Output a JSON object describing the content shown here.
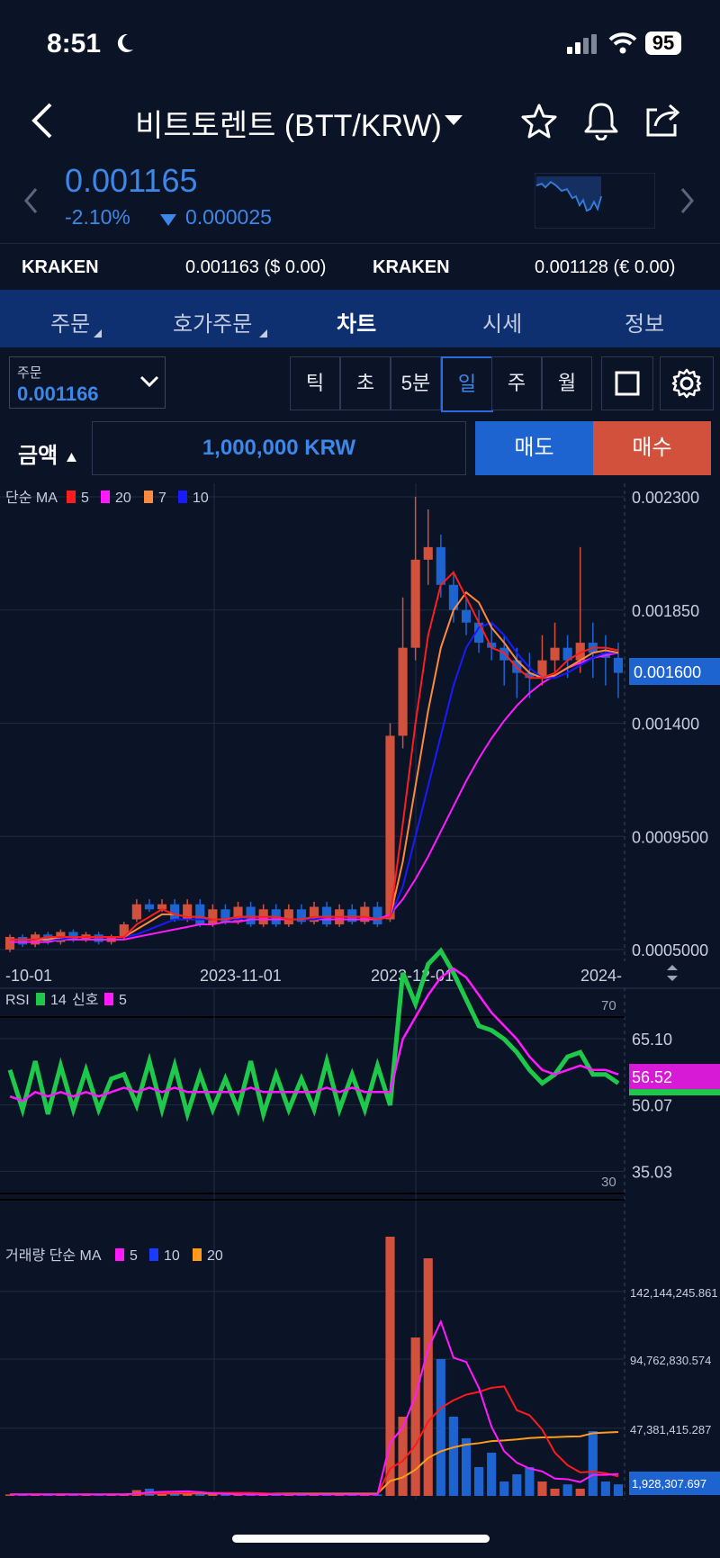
{
  "status": {
    "time": "8:51",
    "battery": "95"
  },
  "header": {
    "title": "비트토렌트 (BTT/KRW)"
  },
  "ticker": {
    "price": "0.001165",
    "change_pct": "-2.10%",
    "change_abs": "0.000025"
  },
  "exchanges": [
    {
      "name": "KRAKEN",
      "value": "0.001163 ($ 0.00)"
    },
    {
      "name": "KRAKEN",
      "value": "0.001128 (€ 0.00)"
    }
  ],
  "tabs": [
    "주문",
    "호가주문",
    "차트",
    "시세",
    "정보"
  ],
  "order": {
    "label": "주문",
    "value": "0.001166"
  },
  "timeframes": [
    "틱",
    "초",
    "5분",
    "일",
    "주",
    "월"
  ],
  "amount": {
    "label": "금액",
    "value": "1,000,000 KRW"
  },
  "actions": {
    "sell": "매도",
    "buy": "매수"
  },
  "colors": {
    "up": "#d2513c",
    "down": "#1d64d0",
    "accent": "#3d87e8",
    "bg": "#0b1427"
  },
  "chart_data": {
    "type": "candlestick",
    "price": {
      "legend_title": "단순 MA",
      "ma_legend": [
        {
          "color": "#ff1d1d",
          "value": "5"
        },
        {
          "color": "#ff1aff",
          "value": "20"
        },
        {
          "color": "#ff8a3d",
          "value": "7"
        },
        {
          "color": "#1a1aff",
          "value": "10"
        }
      ],
      "y_ticks": [
        "0.002300",
        "0.001850",
        "0.001400",
        "0.0009500",
        "0.0005000"
      ],
      "current_label": "0.001600",
      "x_ticks": [
        "-10-01",
        "2023-11-01",
        "2023-12-01",
        "2024-"
      ],
      "ma5": [
        0.00054,
        0.00054,
        0.00054,
        0.00055,
        0.00055,
        0.00055,
        0.00055,
        0.00055,
        0.00055,
        0.00055,
        0.0006,
        0.00063,
        0.00066,
        0.00064,
        0.00063,
        0.00063,
        0.00062,
        0.00062,
        0.00063,
        0.00063,
        0.00063,
        0.00063,
        0.00062,
        0.00062,
        0.00063,
        0.00063,
        0.00063,
        0.00063,
        0.00063,
        0.00062,
        0.00063,
        0.001,
        0.0014,
        0.00175,
        0.00195,
        0.002,
        0.0019,
        0.0018,
        0.0017,
        0.00168,
        0.00162,
        0.00158,
        0.00158,
        0.0016,
        0.00165,
        0.00168,
        0.0017,
        0.0017,
        0.00169
      ],
      "ma7": [
        0.00054,
        0.00054,
        0.00054,
        0.00054,
        0.00055,
        0.00055,
        0.00055,
        0.00055,
        0.00055,
        0.00055,
        0.00058,
        0.00061,
        0.00064,
        0.00064,
        0.00063,
        0.00063,
        0.00062,
        0.00062,
        0.00063,
        0.00063,
        0.00063,
        0.00063,
        0.00062,
        0.00062,
        0.00063,
        0.00063,
        0.00063,
        0.00063,
        0.00063,
        0.00062,
        0.00063,
        0.00085,
        0.00115,
        0.00145,
        0.0017,
        0.00185,
        0.00192,
        0.00188,
        0.00178,
        0.00172,
        0.00165,
        0.0016,
        0.00158,
        0.00159,
        0.00162,
        0.00165,
        0.00168,
        0.00169,
        0.00168
      ],
      "ma10": [
        0.00054,
        0.00054,
        0.00054,
        0.00054,
        0.00054,
        0.00055,
        0.00055,
        0.00055,
        0.00055,
        0.00055,
        0.00056,
        0.00058,
        0.0006,
        0.00062,
        0.00062,
        0.00062,
        0.00062,
        0.00062,
        0.00062,
        0.00063,
        0.00063,
        0.00063,
        0.00062,
        0.00062,
        0.00062,
        0.00063,
        0.00063,
        0.00063,
        0.00063,
        0.00062,
        0.00063,
        0.00075,
        0.00095,
        0.00115,
        0.00135,
        0.00155,
        0.0017,
        0.00178,
        0.0018,
        0.00175,
        0.00168,
        0.00162,
        0.00158,
        0.00158,
        0.0016,
        0.00163,
        0.00166,
        0.00168,
        0.00168
      ],
      "ma20": [
        0.00053,
        0.00053,
        0.00053,
        0.00053,
        0.00054,
        0.00054,
        0.00054,
        0.00054,
        0.00054,
        0.00054,
        0.00055,
        0.00056,
        0.00057,
        0.00058,
        0.00059,
        0.0006,
        0.0006,
        0.00061,
        0.00061,
        0.00062,
        0.00062,
        0.00062,
        0.00062,
        0.00062,
        0.00062,
        0.00062,
        0.00062,
        0.00062,
        0.00062,
        0.00062,
        0.00064,
        0.0007,
        0.00078,
        0.00087,
        0.00097,
        0.00107,
        0.00117,
        0.00126,
        0.00134,
        0.00141,
        0.00147,
        0.00152,
        0.00156,
        0.00159,
        0.00162,
        0.00164,
        0.00166,
        0.00167,
        0.00168
      ],
      "candles_open": [
        0.0005,
        0.00055,
        0.00052,
        0.00056,
        0.00053,
        0.00057,
        0.00054,
        0.00056,
        0.00053,
        0.00055,
        0.00062,
        0.00068,
        0.00066,
        0.00068,
        0.00062,
        0.00068,
        0.0006,
        0.00066,
        0.00061,
        0.00067,
        0.0006,
        0.00066,
        0.0006,
        0.00066,
        0.00061,
        0.00067,
        0.0006,
        0.00066,
        0.00061,
        0.00067,
        0.00062,
        0.00135,
        0.0017,
        0.00205,
        0.0021,
        0.00195,
        0.00185,
        0.0018,
        0.00172,
        0.0017,
        0.00165,
        0.0016,
        0.00158,
        0.00165,
        0.0017,
        0.00165,
        0.00172,
        0.00168,
        0.00166
      ],
      "candles_close": [
        0.00055,
        0.00052,
        0.00056,
        0.00053,
        0.00057,
        0.00054,
        0.00056,
        0.00053,
        0.00055,
        0.0006,
        0.00068,
        0.00066,
        0.00068,
        0.00062,
        0.00068,
        0.0006,
        0.00066,
        0.00061,
        0.00067,
        0.0006,
        0.00066,
        0.0006,
        0.00066,
        0.00061,
        0.00067,
        0.0006,
        0.00066,
        0.00061,
        0.00067,
        0.0006,
        0.00135,
        0.0017,
        0.00205,
        0.0021,
        0.00195,
        0.00185,
        0.0018,
        0.00172,
        0.0017,
        0.00165,
        0.0016,
        0.00158,
        0.00165,
        0.0017,
        0.00165,
        0.00172,
        0.00168,
        0.00166,
        0.0016
      ],
      "candles_high": [
        0.00056,
        0.00056,
        0.00057,
        0.00057,
        0.00058,
        0.00058,
        0.00057,
        0.00057,
        0.00056,
        0.00061,
        0.0007,
        0.0007,
        0.0007,
        0.0007,
        0.0007,
        0.0007,
        0.00068,
        0.00068,
        0.00069,
        0.00069,
        0.00068,
        0.00068,
        0.00068,
        0.00068,
        0.00069,
        0.00069,
        0.00068,
        0.00068,
        0.00069,
        0.00069,
        0.0014,
        0.0019,
        0.0023,
        0.00225,
        0.00215,
        0.002,
        0.0019,
        0.00185,
        0.0018,
        0.00175,
        0.0017,
        0.00168,
        0.00175,
        0.0018,
        0.00175,
        0.0021,
        0.0018,
        0.00175,
        0.00172
      ],
      "candles_low": [
        0.00049,
        0.00051,
        0.00051,
        0.00052,
        0.00052,
        0.00053,
        0.00053,
        0.00052,
        0.00052,
        0.00054,
        0.00061,
        0.00065,
        0.00065,
        0.00061,
        0.00061,
        0.00059,
        0.00059,
        0.0006,
        0.0006,
        0.00059,
        0.00059,
        0.00059,
        0.00059,
        0.0006,
        0.0006,
        0.00059,
        0.00059,
        0.0006,
        0.0006,
        0.00059,
        0.00061,
        0.0013,
        0.00165,
        0.00195,
        0.0019,
        0.0018,
        0.00175,
        0.00168,
        0.00165,
        0.00155,
        0.0015,
        0.0015,
        0.00155,
        0.0016,
        0.00158,
        0.0016,
        0.00158,
        0.00155,
        0.0015
      ]
    },
    "rsi": {
      "legend_title": "RSI",
      "legend": [
        {
          "color": "#1ec84a",
          "value": "14"
        },
        {
          "label": "신호",
          "color": "#ff1aff",
          "value": "5"
        }
      ],
      "levels": [
        "70",
        "30"
      ],
      "y_ticks": [
        "65.10",
        "50.07",
        "35.03"
      ],
      "current_label": "56.52",
      "rsi14": [
        58,
        49,
        60,
        48,
        59,
        49,
        58,
        49,
        56,
        57,
        50,
        60,
        49,
        59,
        48,
        57,
        49,
        56,
        49,
        60,
        48,
        57,
        49,
        56,
        49,
        60,
        49,
        57,
        49,
        59,
        50,
        80,
        73,
        82,
        85,
        80,
        74,
        68,
        67,
        65,
        62,
        58,
        55,
        57,
        61,
        62,
        57,
        57,
        55
      ],
      "signal": [
        52,
        51,
        53,
        52,
        53,
        52,
        53,
        52,
        53,
        54,
        53,
        54,
        53,
        54,
        53,
        53,
        53,
        53,
        53,
        54,
        53,
        53,
        53,
        53,
        53,
        54,
        53,
        54,
        53,
        53,
        53,
        65,
        70,
        75,
        79,
        81,
        79,
        75,
        71,
        68,
        65,
        61,
        58,
        57,
        58,
        59,
        58,
        58,
        57
      ]
    },
    "volume": {
      "legend_title": "거래량 단순 MA",
      "legend": [
        {
          "color": "#ff1aff",
          "value": "5"
        },
        {
          "color": "#1a3aff",
          "value": "10"
        },
        {
          "color": "#ff9a1a",
          "value": "20"
        }
      ],
      "y_ticks": [
        "142,144,245.861",
        "94,762,830.574",
        "47,381,415.287"
      ],
      "current_label": "1,928,307.697",
      "values_m": [
        1,
        1,
        1,
        1,
        1,
        1,
        1,
        1,
        1,
        1,
        4,
        5,
        3,
        2,
        2,
        1,
        1,
        1,
        1,
        1,
        1,
        1,
        1,
        1,
        1,
        1,
        1,
        1,
        1,
        1,
        180,
        55,
        110,
        165,
        95,
        55,
        40,
        20,
        30,
        10,
        15,
        20,
        10,
        5,
        8,
        5,
        45,
        10,
        8
      ],
      "up": [
        true,
        false,
        true,
        false,
        true,
        false,
        true,
        false,
        true,
        true,
        true,
        false,
        true,
        false,
        true,
        false,
        true,
        false,
        true,
        false,
        true,
        false,
        true,
        false,
        true,
        false,
        true,
        false,
        true,
        false,
        true,
        true,
        true,
        true,
        false,
        false,
        false,
        false,
        false,
        false,
        false,
        false,
        true,
        true,
        false,
        true,
        false,
        false,
        false
      ]
    }
  }
}
